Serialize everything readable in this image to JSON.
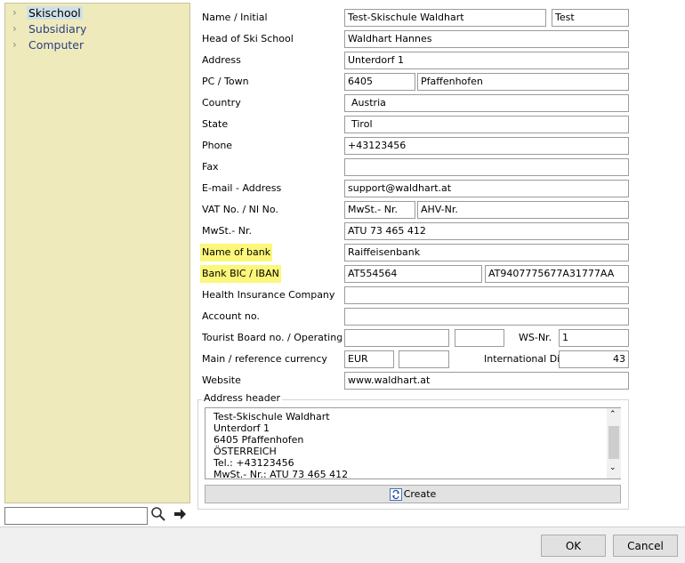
{
  "tree": {
    "items": [
      {
        "label": "Skischool",
        "selected": true
      },
      {
        "label": "Subsidiary",
        "selected": false
      },
      {
        "label": "Computer",
        "selected": false
      }
    ],
    "search_value": ""
  },
  "icons": {
    "expand": "chevron-right-icon",
    "search": "magnifier-icon",
    "go": "arrow-right-icon",
    "create": "refresh-icon"
  },
  "form": {
    "name_initial": {
      "label": "Name / Initial",
      "name": "Test-Skischule Waldhart",
      "initial": "Test"
    },
    "head": {
      "label": "Head of Ski School",
      "value": "Waldhart Hannes"
    },
    "address": {
      "label": "Address",
      "value": "Unterdorf 1"
    },
    "pc_town": {
      "label": "PC / Town",
      "pc": "6405",
      "town": "Pfaffenhofen"
    },
    "country": {
      "label": "Country",
      "value": "Austria"
    },
    "state": {
      "label": "State",
      "value": "Tirol"
    },
    "phone": {
      "label": "Phone",
      "value": "+43123456"
    },
    "fax": {
      "label": "Fax",
      "value": ""
    },
    "email": {
      "label": "E-mail - Address",
      "value": "support@waldhart.at"
    },
    "vat_ni": {
      "label": "VAT No. / NI No.",
      "vat": "MwSt.- Nr.",
      "ni": "AHV-Nr."
    },
    "mwst": {
      "label": "MwSt.- Nr.",
      "value": "ATU 73 465 412"
    },
    "bank_name": {
      "label": "Name of bank",
      "value": "Raiffeisenbank"
    },
    "bank_bic_iban": {
      "label": "Bank BIC / IBAN",
      "bic": "AT554564",
      "iban": "AT9407775677A31777AA"
    },
    "health": {
      "label": "Health Insurance Company",
      "value": ""
    },
    "account": {
      "label": "Account no.",
      "value": ""
    },
    "tourist": {
      "label": "Tourist Board no. / Operating mo",
      "value1": "",
      "value2": "",
      "ws_label": "WS-Nr.",
      "ws_value": "1"
    },
    "currency": {
      "label": "Main / reference currency",
      "main": "EUR",
      "reference": "",
      "dial_label": "International Diall",
      "dial_value": "43"
    },
    "website": {
      "label": "Website",
      "value": "www.waldhart.at"
    }
  },
  "address_header": {
    "legend": "Address header",
    "lines": [
      "Test-Skischule Waldhart",
      "Unterdorf 1",
      "6405 Pfaffenhofen",
      "ÖSTERREICH",
      "Tel.: +43123456",
      "MwSt.- Nr.: ATU 73 465 412"
    ],
    "create_label": "Create"
  },
  "buttons": {
    "ok": "OK",
    "cancel": "Cancel"
  },
  "colors": {
    "tree_bg": "#eeeabb",
    "highlight": "#fcf77a",
    "link": "#2c3e86"
  }
}
